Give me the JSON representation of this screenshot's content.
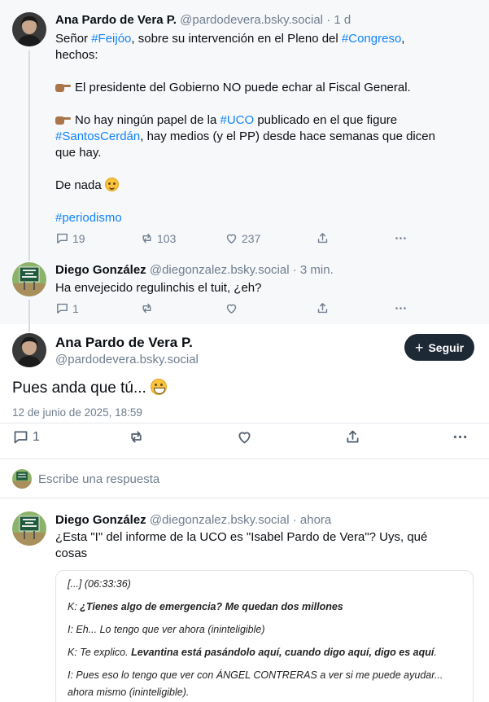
{
  "parent_post": {
    "author_name": "Ana Pardo de Vera P.",
    "handle": "@pardodevera.bsky.social",
    "time": "· 1 d",
    "line1_prefix": "Señor ",
    "hashtag_feijoo": "#Feijóo",
    "line1_mid": ", sobre su intervención en el Pleno del ",
    "hashtag_congreso": "#Congreso",
    "line1_suffix": ",",
    "line2": "hechos:",
    "point1": "El presidente del Gobierno NO puede echar al Fiscal General.",
    "point2_prefix": "No hay ningún papel de la ",
    "hashtag_uco": "#UCO",
    "point2_mid": " publicado en el que figure",
    "hashtag_santos": "#SantosCerdán",
    "point2_suffix": ", hay medios (y el PP) desde hace semanas que dicen",
    "point2_end": "que hay.",
    "closing": "De nada",
    "hashtag_periodismo": "#periodismo",
    "replies": "19",
    "reposts": "103",
    "likes": "237"
  },
  "reply_post": {
    "author_name": "Diego González",
    "handle": "@diegonzalez.bsky.social",
    "time": "· 3 min.",
    "text": "Ha envejecido regulinchis el tuit, ¿eh?",
    "replies": "1"
  },
  "focused_post": {
    "author_name": "Ana Pardo de Vera P.",
    "handle": "@pardodevera.bsky.social",
    "follow_label": "Seguir",
    "text": "Pues anda que tú...",
    "timestamp": "12 de junio de 2025, 18:59",
    "replies": "1"
  },
  "reply_composer": {
    "placeholder": "Escribe una respuesta"
  },
  "bottom_post": {
    "author_name": "Diego González",
    "handle": "@diegonzalez.bsky.social",
    "time": "· ahora",
    "text_line1": "¿Esta \"I\" del informe de la UCO es \"Isabel Pardo de Vera\"? Uys, qué",
    "text_line2": "cosas",
    "embed": {
      "line1": "[...] (06:33:36)",
      "line2_prefix": "K: ",
      "line2_bold": "¿Tienes algo de emergencia? Me quedan dos millones",
      "line3": "I: Eh... Lo tengo que ver ahora (ininteligible)",
      "line4_prefix": "K: Te explico. ",
      "line4_bold": "Levantina está pasándolo aquí, cuando digo aquí, digo es aquí",
      "line4_suffix": ".",
      "line5": "I: Pues eso lo tengo que ver con ÁNGEL CONTRERAS a ver si me puede ayudar...",
      "line6": "ahora mismo (ininteligible)."
    }
  },
  "colors": {
    "link": "#1083fe",
    "muted": "#6f7e8e",
    "follow_button": "#1e2936"
  }
}
